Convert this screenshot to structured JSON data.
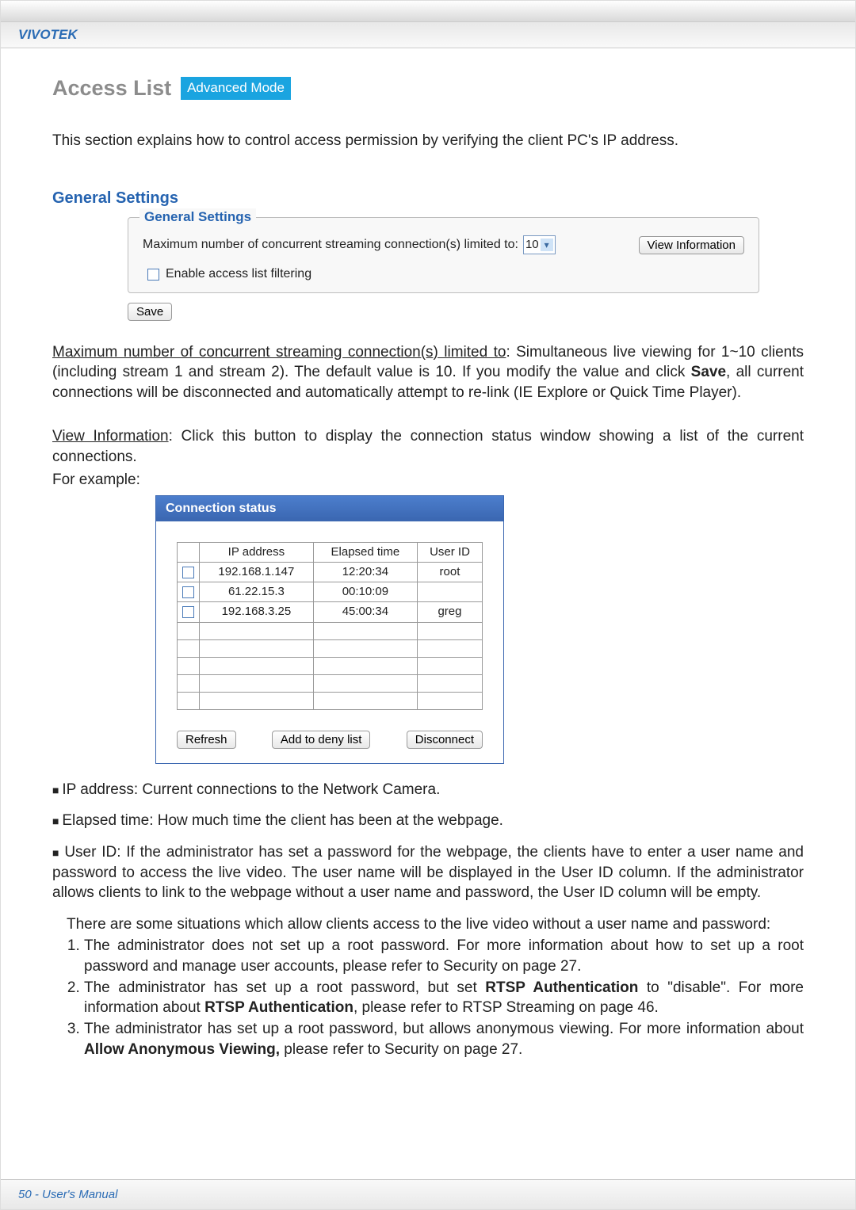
{
  "brand": "VIVOTEK",
  "page_title": "Access List",
  "advanced_badge": "Advanced Mode",
  "intro_text": "This section explains how to control access permission by verifying the client PC's IP address.",
  "section_heading": "General Settings",
  "fieldset": {
    "legend": "General Settings",
    "max_conn_label": "Maximum number of concurrent streaming connection(s) limited to:",
    "max_conn_value": "10",
    "view_info_btn": "View Information",
    "enable_filter_label": "Enable access list filtering",
    "save_btn": "Save"
  },
  "paragraphs": {
    "p1_underline": "Maximum number of concurrent streaming connection(s) limited to",
    "p1_rest": ": Simultaneous live viewing for 1~10 clients (including stream 1 and stream 2). The default value is 10. If you modify the value and click ",
    "p1_bold": "Save",
    "p1_tail": ", all current connections will be disconnected and automatically attempt to re-link (IE Explore or Quick Time Player).",
    "p2_underline": "View Information",
    "p2_rest": ": Click this button to display the connection status window showing a list of the current connections.",
    "p2_example": "For example:"
  },
  "connection_status": {
    "title": "Connection status",
    "headers": [
      "",
      "IP address",
      "Elapsed time",
      "User ID"
    ],
    "rows": [
      {
        "checkbox": true,
        "ip": "192.168.1.147",
        "elapsed": "12:20:34",
        "user": "root"
      },
      {
        "checkbox": true,
        "ip": "61.22.15.3",
        "elapsed": "00:10:09",
        "user": ""
      },
      {
        "checkbox": true,
        "ip": "192.168.3.25",
        "elapsed": "45:00:34",
        "user": "greg"
      },
      {
        "checkbox": false,
        "ip": "",
        "elapsed": "",
        "user": ""
      },
      {
        "checkbox": false,
        "ip": "",
        "elapsed": "",
        "user": ""
      },
      {
        "checkbox": false,
        "ip": "",
        "elapsed": "",
        "user": ""
      },
      {
        "checkbox": false,
        "ip": "",
        "elapsed": "",
        "user": ""
      },
      {
        "checkbox": false,
        "ip": "",
        "elapsed": "",
        "user": ""
      }
    ],
    "buttons": {
      "refresh": "Refresh",
      "deny": "Add to deny list",
      "disconnect": "Disconnect"
    }
  },
  "bullets": {
    "b1": "IP address: Current connections to the Network Camera.",
    "b2": "Elapsed time: How much time the client has been at the webpage.",
    "b3_lead": "User ID: If the administrator has set a password for the webpage, the clients have to enter a user name and password to access the live video. The user name will be displayed in the User ID column. If  the administrator allows clients to link to the webpage without a user name and password, the User ID column will be empty.",
    "b3_followup": "There are some situations which allow clients access to the live video without a user name and password:",
    "ol1": "The administrator does not set up a root password. For more information about how to set up a root password and manage user accounts, please refer to Security on page 27.",
    "ol2_a": "The administrator has set up a root password, but set ",
    "ol2_bold1": "RTSP Authentication",
    "ol2_b": " to \"disable\". For more information about ",
    "ol2_bold2": "RTSP Authentication",
    "ol2_c": ", please refer to RTSP Streaming on page 46.",
    "ol3_a": "The administrator has set up a root password, but allows anonymous viewing. For more information about ",
    "ol3_bold": "Allow Anonymous Viewing,",
    "ol3_b": " please refer to Security on page 27."
  },
  "footer": "50 - User's Manual"
}
